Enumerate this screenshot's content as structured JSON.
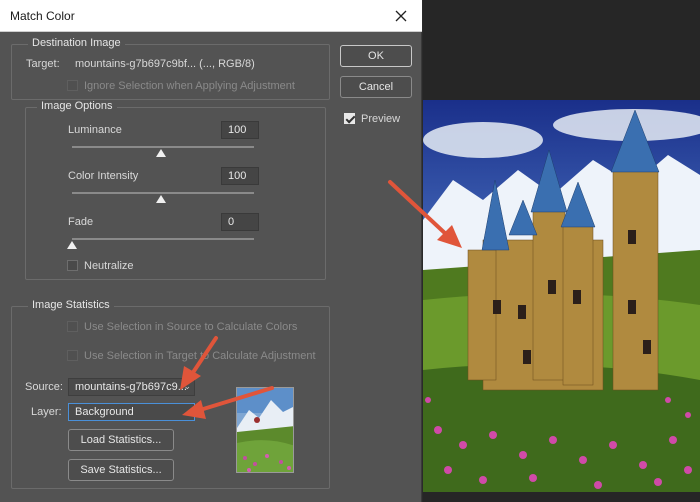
{
  "dialog": {
    "title": "Match Color",
    "destination": {
      "legend": "Destination Image",
      "target_label": "Target:",
      "target_value": "mountains-g7b697c9bf... (..., RGB/8)",
      "ignore_selection": "Ignore Selection when Applying Adjustment"
    },
    "image_options": {
      "legend": "Image Options",
      "luminance_label": "Luminance",
      "luminance_value": "100",
      "luminance_level": 100,
      "color_intensity_label": "Color Intensity",
      "color_intensity_value": "100",
      "color_intensity_level": 100,
      "fade_label": "Fade",
      "fade_value": "0",
      "fade_level": 0,
      "neutralize_label": "Neutralize"
    },
    "image_statistics": {
      "legend": "Image Statistics",
      "use_sel_source": "Use Selection in Source to Calculate Colors",
      "use_sel_target": "Use Selection in Target to Calculate Adjustment",
      "source_label": "Source:",
      "source_value": "mountains-g7b697c9...",
      "layer_label": "Layer:",
      "layer_value": "Background",
      "load_stats": "Load Statistics...",
      "save_stats": "Save Statistics..."
    },
    "buttons": {
      "ok": "OK",
      "cancel": "Cancel"
    },
    "preview_label": "Preview",
    "preview_checked": true
  },
  "colors": {
    "dialog_bg": "#535353",
    "arrow": "#e0553a"
  },
  "icons": [
    "close-icon",
    "chevron-down-icon",
    "checkbox-checked-icon",
    "arrow-annotation"
  ]
}
